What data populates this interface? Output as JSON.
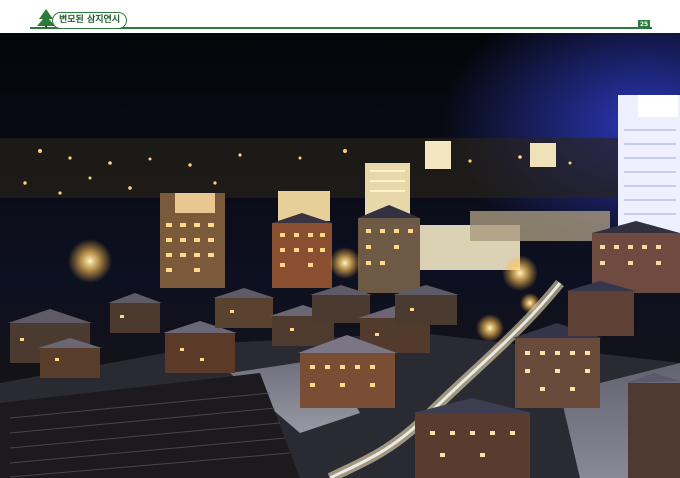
{
  "header": {
    "title": "변모된 삼지연시",
    "page_number": "25",
    "accent_color": "#2d7a3a"
  },
  "photo": {
    "icon": "night-city-photo",
    "sky_color": "#07080d",
    "glow_color": "#ffd27a",
    "snow_color": "#d9d9e6"
  }
}
